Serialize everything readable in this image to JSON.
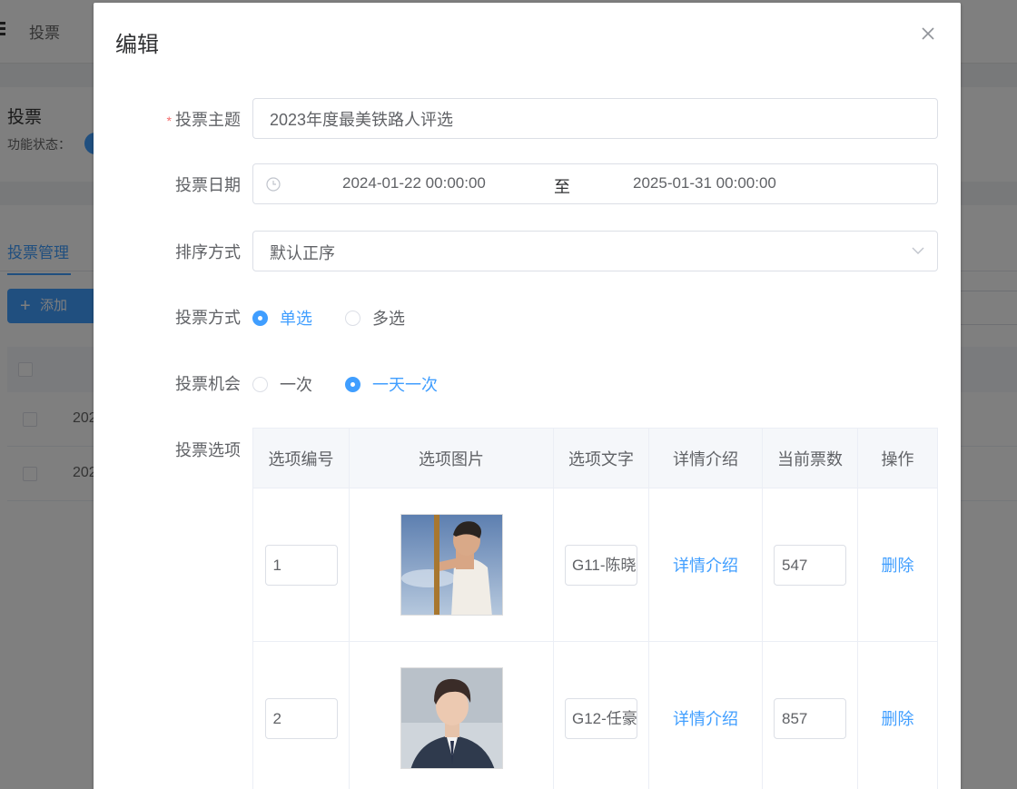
{
  "background": {
    "breadcrumb": "投票",
    "section_title": "投票",
    "status_label": "功能状态：",
    "tab": "投票管理",
    "add_button": "添加",
    "rows": [
      "202",
      "202"
    ]
  },
  "dialog": {
    "title": "编辑",
    "fields": {
      "subject_label": "投票主题",
      "subject_value": "2023年度最美铁路人评选",
      "date_label": "投票日期",
      "date_start": "2024-01-22 00:00:00",
      "date_separator": "至",
      "date_end": "2025-01-31 00:00:00",
      "sort_label": "排序方式",
      "sort_value": "默认正序",
      "mode_label": "投票方式",
      "mode_options": [
        "单选",
        "多选"
      ],
      "mode_selected": "单选",
      "chance_label": "投票机会",
      "chance_options": [
        "一次",
        "一天一次"
      ],
      "chance_selected": "一天一次",
      "options_label": "投票选项"
    },
    "table": {
      "headers": [
        "选项编号",
        "选项图片",
        "选项文字",
        "详情介绍",
        "当前票数",
        "操作"
      ],
      "rows": [
        {
          "number": "1",
          "text": "G11-陈晓",
          "detail_link": "详情介绍",
          "votes": "547",
          "action": "删除"
        },
        {
          "number": "2",
          "text": "G12-任豪",
          "detail_link": "详情介绍",
          "votes": "857",
          "action": "删除"
        }
      ]
    }
  },
  "colors": {
    "primary": "#409eff",
    "required": "#f56c6c"
  }
}
